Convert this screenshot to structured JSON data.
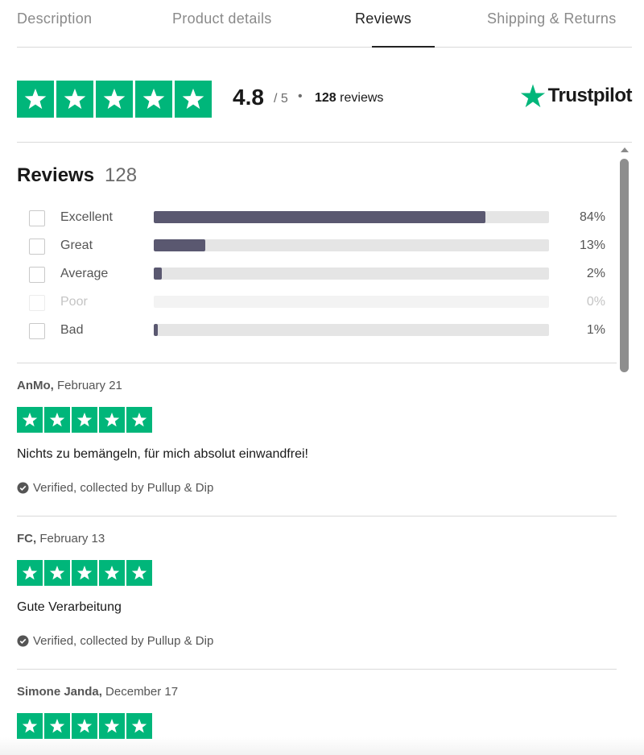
{
  "tabs": [
    {
      "label": "Description"
    },
    {
      "label": "Product details"
    },
    {
      "label": "Reviews"
    },
    {
      "label": "Shipping & Returns"
    }
  ],
  "active_tab": "Reviews",
  "summary": {
    "score": "4.8",
    "out_of": "/ 5",
    "separator": "•",
    "review_count": "128",
    "reviews_word": "reviews",
    "star_rating": 5,
    "brand": "Trustpilot"
  },
  "section": {
    "heading": "Reviews",
    "count": "128"
  },
  "distribution": [
    {
      "label": "Excellent",
      "pct": "84%",
      "value": 0.84,
      "enabled": true
    },
    {
      "label": "Great",
      "pct": "13%",
      "value": 0.13,
      "enabled": true
    },
    {
      "label": "Average",
      "pct": "2%",
      "value": 0.02,
      "enabled": true
    },
    {
      "label": "Poor",
      "pct": "0%",
      "value": 0,
      "enabled": false
    },
    {
      "label": "Bad",
      "pct": "1%",
      "value": 0.01,
      "enabled": true
    }
  ],
  "reviews": [
    {
      "author": "AnMo,",
      "date": "February 21",
      "stars": 5,
      "text": "Nichts zu bemängeln, für mich absolut einwandfrei!",
      "verified": "Verified, collected by Pullup & Dip"
    },
    {
      "author": "FC,",
      "date": "February 13",
      "stars": 5,
      "text": "Gute Verarbeitung",
      "verified": "Verified, collected by Pullup & Dip"
    },
    {
      "author": "Simone Janda,",
      "date": "December 17",
      "stars": 5,
      "text": "",
      "verified": ""
    }
  ],
  "colors": {
    "trustpilot_green": "#00b67a",
    "bar_fill": "#5a5870",
    "bar_track": "#e5e5e5"
  },
  "icons": {
    "star": "star-icon",
    "verified": "check-circle-icon",
    "brand": "trustpilot-star-icon"
  }
}
